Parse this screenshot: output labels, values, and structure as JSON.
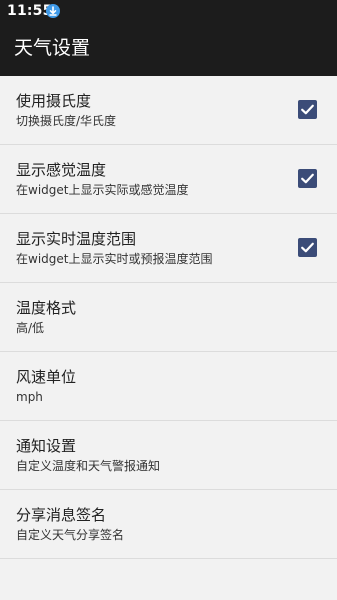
{
  "status_bar": {
    "time": "11:55",
    "icon": "download-icon"
  },
  "app_bar": {
    "title": "天气设置"
  },
  "prefs": [
    {
      "title": "使用摄氏度",
      "summary": "切换摄氏度/华氏度",
      "checked": true
    },
    {
      "title": "显示感觉温度",
      "summary": "在widget上显示实际或感觉温度",
      "checked": true
    },
    {
      "title": "显示实时温度范围",
      "summary": "在widget上显示实时或预报温度范围",
      "checked": true
    },
    {
      "title": "温度格式",
      "summary": "高/低"
    },
    {
      "title": "风速单位",
      "summary": "mph"
    },
    {
      "title": "通知设置",
      "summary": "自定义温度和天气警报通知"
    },
    {
      "title": "分享消息签名",
      "summary": "自定义天气分享签名"
    }
  ],
  "colors": {
    "bar": "#1c1c1c",
    "background": "#f2f2f2",
    "checkbox": "#3b4c78",
    "accent": "#3f9ae8"
  }
}
